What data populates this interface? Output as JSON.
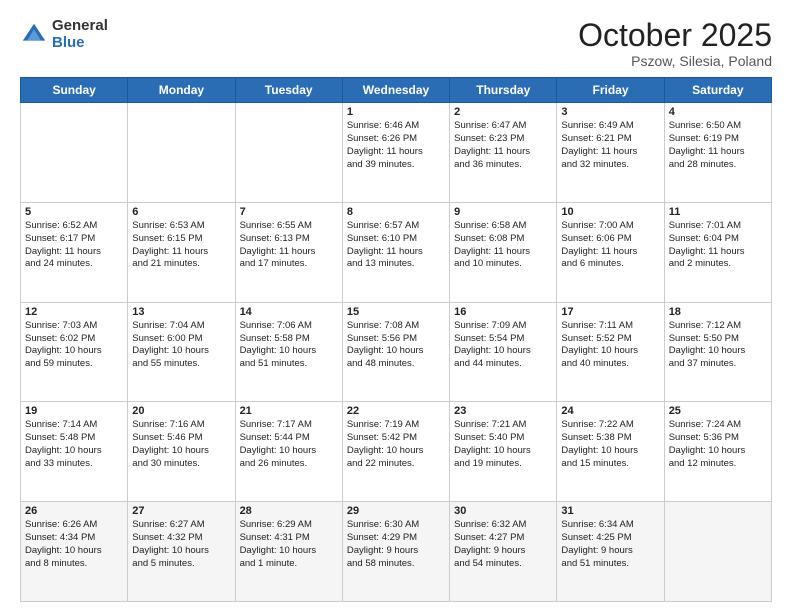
{
  "logo": {
    "general": "General",
    "blue": "Blue"
  },
  "header": {
    "month": "October 2025",
    "location": "Pszow, Silesia, Poland"
  },
  "weekdays": [
    "Sunday",
    "Monday",
    "Tuesday",
    "Wednesday",
    "Thursday",
    "Friday",
    "Saturday"
  ],
  "weeks": [
    [
      {
        "day": "",
        "content": ""
      },
      {
        "day": "",
        "content": ""
      },
      {
        "day": "",
        "content": ""
      },
      {
        "day": "1",
        "content": "Sunrise: 6:46 AM\nSunset: 6:26 PM\nDaylight: 11 hours\nand 39 minutes."
      },
      {
        "day": "2",
        "content": "Sunrise: 6:47 AM\nSunset: 6:23 PM\nDaylight: 11 hours\nand 36 minutes."
      },
      {
        "day": "3",
        "content": "Sunrise: 6:49 AM\nSunset: 6:21 PM\nDaylight: 11 hours\nand 32 minutes."
      },
      {
        "day": "4",
        "content": "Sunrise: 6:50 AM\nSunset: 6:19 PM\nDaylight: 11 hours\nand 28 minutes."
      }
    ],
    [
      {
        "day": "5",
        "content": "Sunrise: 6:52 AM\nSunset: 6:17 PM\nDaylight: 11 hours\nand 24 minutes."
      },
      {
        "day": "6",
        "content": "Sunrise: 6:53 AM\nSunset: 6:15 PM\nDaylight: 11 hours\nand 21 minutes."
      },
      {
        "day": "7",
        "content": "Sunrise: 6:55 AM\nSunset: 6:13 PM\nDaylight: 11 hours\nand 17 minutes."
      },
      {
        "day": "8",
        "content": "Sunrise: 6:57 AM\nSunset: 6:10 PM\nDaylight: 11 hours\nand 13 minutes."
      },
      {
        "day": "9",
        "content": "Sunrise: 6:58 AM\nSunset: 6:08 PM\nDaylight: 11 hours\nand 10 minutes."
      },
      {
        "day": "10",
        "content": "Sunrise: 7:00 AM\nSunset: 6:06 PM\nDaylight: 11 hours\nand 6 minutes."
      },
      {
        "day": "11",
        "content": "Sunrise: 7:01 AM\nSunset: 6:04 PM\nDaylight: 11 hours\nand 2 minutes."
      }
    ],
    [
      {
        "day": "12",
        "content": "Sunrise: 7:03 AM\nSunset: 6:02 PM\nDaylight: 10 hours\nand 59 minutes."
      },
      {
        "day": "13",
        "content": "Sunrise: 7:04 AM\nSunset: 6:00 PM\nDaylight: 10 hours\nand 55 minutes."
      },
      {
        "day": "14",
        "content": "Sunrise: 7:06 AM\nSunset: 5:58 PM\nDaylight: 10 hours\nand 51 minutes."
      },
      {
        "day": "15",
        "content": "Sunrise: 7:08 AM\nSunset: 5:56 PM\nDaylight: 10 hours\nand 48 minutes."
      },
      {
        "day": "16",
        "content": "Sunrise: 7:09 AM\nSunset: 5:54 PM\nDaylight: 10 hours\nand 44 minutes."
      },
      {
        "day": "17",
        "content": "Sunrise: 7:11 AM\nSunset: 5:52 PM\nDaylight: 10 hours\nand 40 minutes."
      },
      {
        "day": "18",
        "content": "Sunrise: 7:12 AM\nSunset: 5:50 PM\nDaylight: 10 hours\nand 37 minutes."
      }
    ],
    [
      {
        "day": "19",
        "content": "Sunrise: 7:14 AM\nSunset: 5:48 PM\nDaylight: 10 hours\nand 33 minutes."
      },
      {
        "day": "20",
        "content": "Sunrise: 7:16 AM\nSunset: 5:46 PM\nDaylight: 10 hours\nand 30 minutes."
      },
      {
        "day": "21",
        "content": "Sunrise: 7:17 AM\nSunset: 5:44 PM\nDaylight: 10 hours\nand 26 minutes."
      },
      {
        "day": "22",
        "content": "Sunrise: 7:19 AM\nSunset: 5:42 PM\nDaylight: 10 hours\nand 22 minutes."
      },
      {
        "day": "23",
        "content": "Sunrise: 7:21 AM\nSunset: 5:40 PM\nDaylight: 10 hours\nand 19 minutes."
      },
      {
        "day": "24",
        "content": "Sunrise: 7:22 AM\nSunset: 5:38 PM\nDaylight: 10 hours\nand 15 minutes."
      },
      {
        "day": "25",
        "content": "Sunrise: 7:24 AM\nSunset: 5:36 PM\nDaylight: 10 hours\nand 12 minutes."
      }
    ],
    [
      {
        "day": "26",
        "content": "Sunrise: 6:26 AM\nSunset: 4:34 PM\nDaylight: 10 hours\nand 8 minutes."
      },
      {
        "day": "27",
        "content": "Sunrise: 6:27 AM\nSunset: 4:32 PM\nDaylight: 10 hours\nand 5 minutes."
      },
      {
        "day": "28",
        "content": "Sunrise: 6:29 AM\nSunset: 4:31 PM\nDaylight: 10 hours\nand 1 minute."
      },
      {
        "day": "29",
        "content": "Sunrise: 6:30 AM\nSunset: 4:29 PM\nDaylight: 9 hours\nand 58 minutes."
      },
      {
        "day": "30",
        "content": "Sunrise: 6:32 AM\nSunset: 4:27 PM\nDaylight: 9 hours\nand 54 minutes."
      },
      {
        "day": "31",
        "content": "Sunrise: 6:34 AM\nSunset: 4:25 PM\nDaylight: 9 hours\nand 51 minutes."
      },
      {
        "day": "",
        "content": ""
      }
    ]
  ]
}
